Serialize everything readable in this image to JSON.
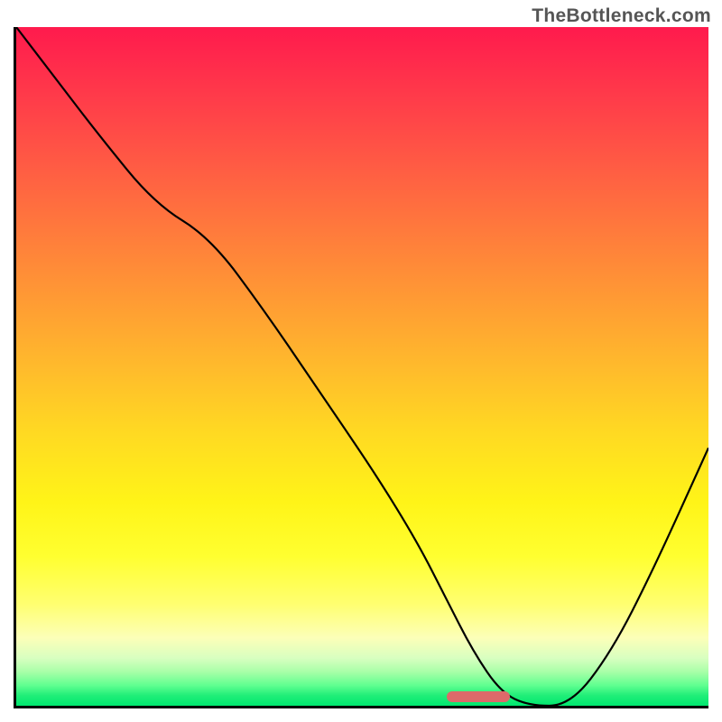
{
  "watermark": "TheBottleneck.com",
  "chart_data": {
    "type": "line",
    "title": "",
    "xlabel": "",
    "ylabel": "",
    "xlim": [
      0,
      100
    ],
    "ylim": [
      0,
      100
    ],
    "x": [
      0,
      6,
      12,
      20,
      28,
      36,
      44,
      52,
      58,
      62,
      66,
      70,
      74,
      80,
      86,
      92,
      100
    ],
    "values": [
      100,
      92,
      84,
      74,
      69,
      58,
      46,
      34,
      24,
      16,
      8,
      2,
      0,
      0,
      8,
      20,
      38
    ],
    "annotations": [
      {
        "type": "marker",
        "x_start": 62,
        "x_end": 71,
        "y": 0,
        "color": "#dd6a6a"
      }
    ],
    "background_gradient": {
      "stops": [
        {
          "pos": 0.0,
          "color": "#ff1a4d"
        },
        {
          "pos": 0.5,
          "color": "#ffba2c"
        },
        {
          "pos": 0.78,
          "color": "#ffff30"
        },
        {
          "pos": 0.95,
          "color": "#a8ffa8"
        },
        {
          "pos": 1.0,
          "color": "#00e870"
        }
      ]
    }
  }
}
